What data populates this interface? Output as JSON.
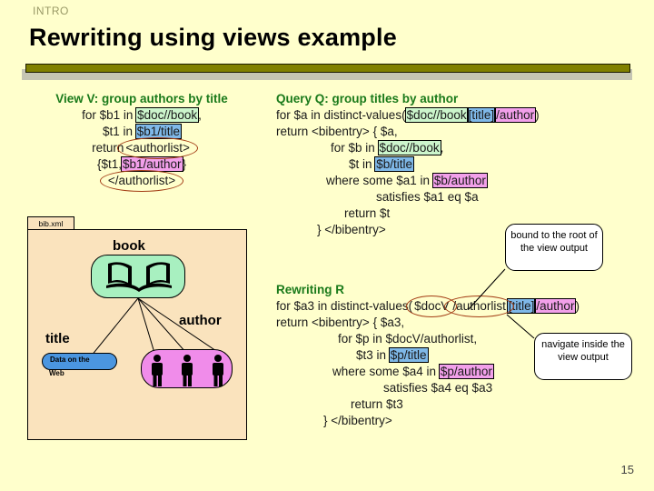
{
  "slide": {
    "kicker": "INTRO",
    "title": "Rewriting using views example",
    "page_number": "15",
    "background": "#ffffcc",
    "rule_color": "#808000",
    "heading_color": "#1a7a1a"
  },
  "highlight_colors": {
    "green": "#ccf5cc",
    "blue": "#7fb8e8",
    "pink": "#f2a0ea",
    "ellipse": "#a33c14"
  },
  "view_v": {
    "header": "View V: group authors by title",
    "line1_a": "for $b1 in ",
    "line1_hl": "$doc//book",
    "line1_b": ",",
    "line2_a": "$t1  in ",
    "line2_hl": "$b1/title",
    "line3_a": "return",
    "line3_ellipse": "<authorlist>",
    "line4_a": "{$t1,",
    "line4_hl": "$b1/author",
    "line4_b": "}",
    "line5_ellipse": "</authorlist>"
  },
  "query_q": {
    "header": "Query Q: group titles by author",
    "l1_a": "for $a in distinct-values(",
    "l1_green": "$doc//book",
    "l1_blue": "[title]",
    "l1_pink": "/author",
    "l1_b": ")",
    "l2": "return <bibentry> { $a,",
    "l3_a": "for $b in ",
    "l3_green": "$doc//book",
    "l3_b": ",",
    "l4_a": "$t  in ",
    "l4_blue": "$b/title",
    "l5_a": "where some $a1 in ",
    "l5_pink": "$b/author",
    "l6": "satisfies $a1 eq $a",
    "l7": "return $t",
    "l8": "} </bibentry>"
  },
  "rewriting_r": {
    "header": "Rewriting R",
    "l1_a": "for $a3 in distinct-values(",
    "l1_ell1": "$docV",
    "l1_ell2": "/authorlist",
    "l1_blue": "[title]",
    "l1_pink": "/author",
    "l1_b": ")",
    "l2": "return <bibentry> { $a3,",
    "l3": "for $p  in $docV/authorlist,",
    "l4_a": "$t3 in ",
    "l4_blue": "$p/title",
    "l5_a": "where some $a4 in ",
    "l5_pink": "$p/author",
    "l6": "satisfies $a4 eq $a3",
    "l7": "return $t3",
    "l8": "} </bibentry>"
  },
  "callouts": {
    "bound": "bound to the root of the view output",
    "navigate": "navigate inside the view output"
  },
  "diagram": {
    "package_tab": "bib.xml",
    "book_label": "book",
    "title_label": "title",
    "author_label": "author",
    "title_value_line1": "Data on the",
    "title_value_line2": "Web",
    "book_color": "#a8f0c0",
    "title_color": "#4b96e0",
    "author_color": "#f08cea",
    "package_color": "#fae3bd"
  }
}
